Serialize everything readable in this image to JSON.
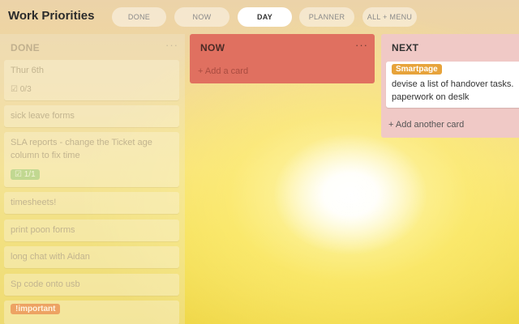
{
  "header": {
    "title": "Work Priorities",
    "tabs": [
      {
        "label": "DONE"
      },
      {
        "label": "NOW"
      },
      {
        "label": "DAY",
        "active": true
      },
      {
        "label": "PLANNER"
      },
      {
        "label": "ALL + MENU"
      }
    ]
  },
  "lists": {
    "done": {
      "title": "DONE",
      "menu": "···",
      "cards": [
        {
          "text": "Thur 6th",
          "badge": "☑ 0/3"
        },
        {
          "text": "sick leave forms"
        },
        {
          "text": "SLA reports - change the Ticket age column to fix time",
          "badge": "☑ 1/1"
        },
        {
          "text": "timesheets!"
        },
        {
          "text": "print poon forms"
        },
        {
          "text": "long chat with Aidan"
        },
        {
          "text": "Sp code onto usb"
        },
        {
          "label": "!important"
        }
      ]
    },
    "now": {
      "title": "NOW",
      "menu": "···",
      "add_label": "+ Add a card"
    },
    "next": {
      "title": "NEXT",
      "card": {
        "label": "Smartpage",
        "line1": "devise a list of handover tasks.",
        "line2": "paperwork on deslk"
      },
      "add_label": "+ Add another card"
    }
  },
  "colors": {
    "now_list": "#e07060",
    "next_list": "#f0c9c6",
    "label_smartpage": "#e7a33b",
    "label_important": "#eb8c50"
  }
}
